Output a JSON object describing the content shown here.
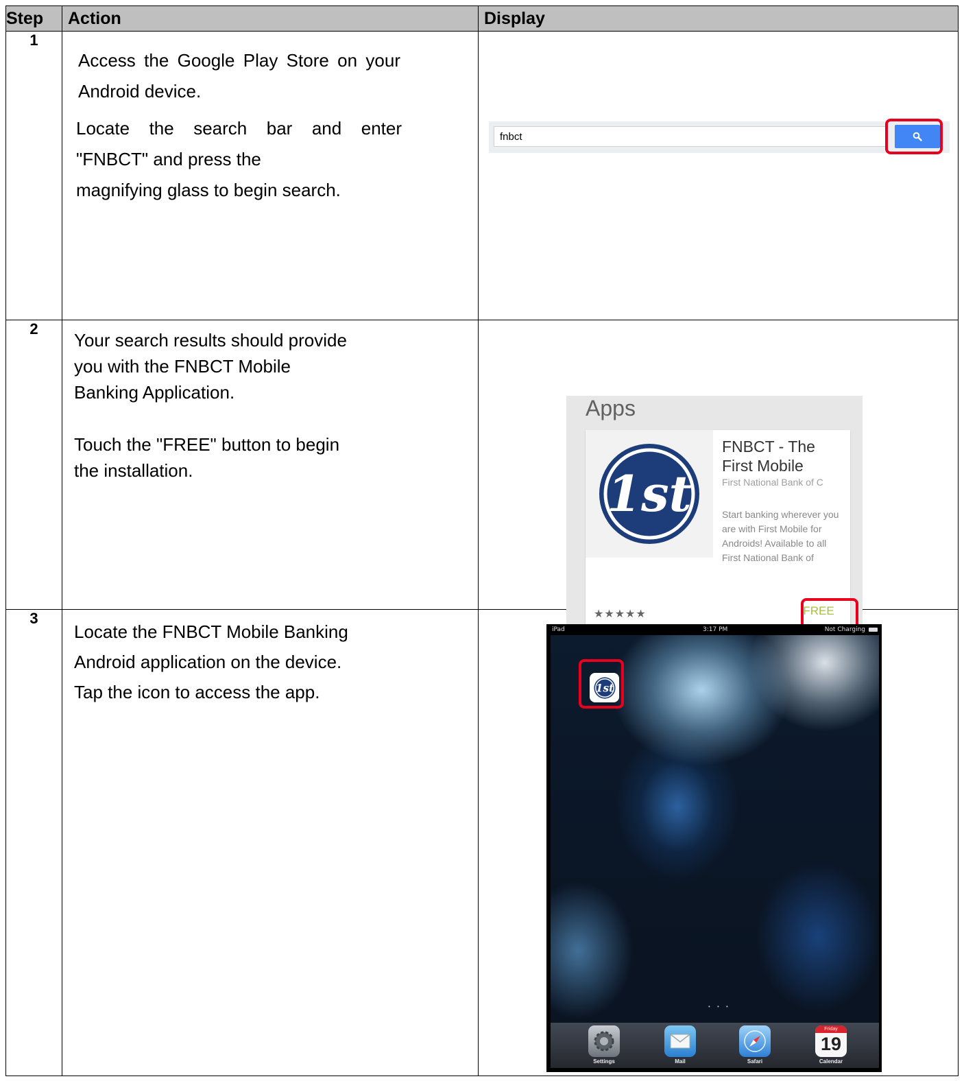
{
  "header": {
    "step": "Step",
    "action": "Action",
    "display": "Display"
  },
  "steps": [
    {
      "number": "1",
      "paragraphs": [
        "Access the Google Play Store on your Android device.",
        "Locate the search bar and enter \"FNBCT\" and press the",
        "magnifying glass to begin search."
      ],
      "search": {
        "value": "fnbct"
      }
    },
    {
      "number": "2",
      "paragraphs": [
        "Your search results should provide",
        "you with the FNBCT Mobile",
        "Banking Application.",
        "Touch the \"FREE\" button to begin",
        "the installation."
      ],
      "app_card": {
        "section_title": "Apps",
        "app_title": "FNBCT - The First Mobile",
        "developer": "First National Bank of C",
        "description": "Start banking wherever you are with First Mobile for Androids! Available to all First National Bank of",
        "stars": "★★★★★",
        "price_label": "FREE",
        "logo_text": "1st"
      }
    },
    {
      "number": "3",
      "paragraphs": [
        "Locate the FNBCT Mobile Banking",
        "Android application on the device.",
        "Tap the icon to access the app."
      ],
      "ipad": {
        "status_left": "iPad",
        "status_time": "3:17 PM",
        "status_right": "Not Charging",
        "dock": [
          "Settings",
          "Mail",
          "Safari",
          "Calendar"
        ],
        "calendar_day": "Friday",
        "calendar_date": "19"
      }
    }
  ],
  "colors": {
    "highlight": "#e8001c",
    "header_bg": "#bfbfbf",
    "search_button": "#4285f4",
    "free_text": "#a6c23c",
    "logo_blue": "#1d3d7a"
  }
}
